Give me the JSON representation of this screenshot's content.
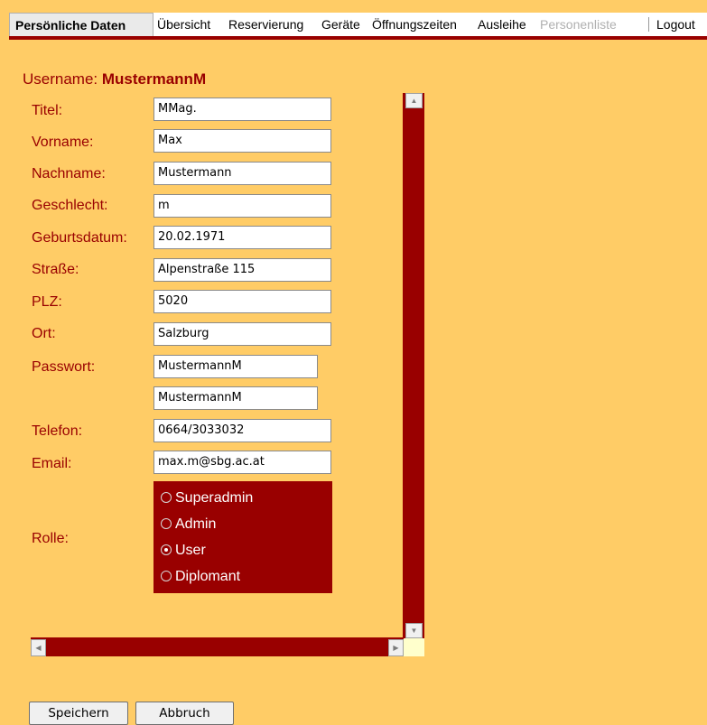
{
  "nav": {
    "tabs": [
      {
        "label": "Persönliche Daten",
        "state": "active"
      },
      {
        "label": "Übersicht",
        "state": "normal"
      },
      {
        "label": "Reservierung",
        "state": "normal"
      },
      {
        "label": "Geräte",
        "state": "normal"
      },
      {
        "label": "Öffnungszeiten",
        "state": "normal"
      },
      {
        "label": "Ausleihe",
        "state": "normal"
      },
      {
        "label": "Personenliste",
        "state": "disabled"
      },
      {
        "label": "Logout",
        "state": "normal"
      }
    ]
  },
  "form": {
    "username_label": "Username:",
    "username_value": "MustermannM",
    "fields": {
      "titel": {
        "label": "Titel:",
        "value": "MMag."
      },
      "vorname": {
        "label": "Vorname:",
        "value": "Max"
      },
      "nachname": {
        "label": "Nachname:",
        "value": "Mustermann"
      },
      "geschlecht": {
        "label": "Geschlecht:",
        "value": "m"
      },
      "geburtsdatum": {
        "label": "Geburtsdatum:",
        "value": "20.02.1971"
      },
      "strasse": {
        "label": "Straße:",
        "value": "Alpenstraße 115"
      },
      "plz": {
        "label": "PLZ:",
        "value": "5020"
      },
      "ort": {
        "label": "Ort:",
        "value": "Salzburg"
      },
      "passwort": {
        "label": "Passwort:",
        "value": "MustermannM"
      },
      "passwort2": {
        "label": "",
        "value": "MustermannM"
      },
      "telefon": {
        "label": "Telefon:",
        "value": "0664/3033032"
      },
      "email": {
        "label": "Email:",
        "value": "max.m@sbg.ac.at"
      }
    },
    "rolle": {
      "label": "Rolle:",
      "options": [
        "Superadmin",
        "Admin",
        "User",
        "Diplomant"
      ],
      "selected": "User"
    }
  },
  "buttons": {
    "save": "Speichern",
    "cancel": "Abbruch"
  },
  "colors": {
    "background": "#ffcc66",
    "accent": "#990000"
  }
}
